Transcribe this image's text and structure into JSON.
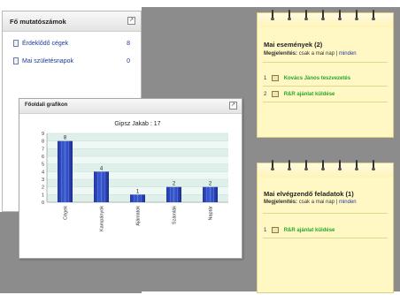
{
  "counters": {
    "title": "Fő mutatószámok",
    "rows": [
      {
        "label": "Érdeklődő cégek",
        "value": "8"
      },
      {
        "label": "Mai születésnapok",
        "value": "0"
      }
    ]
  },
  "chart_window": {
    "title": "Főoldali grafikon"
  },
  "events": {
    "title": "Mai események (2)",
    "display_label": "Megjelenítés:",
    "filter_today": "csak a mai nap",
    "separator": "|",
    "filter_all": "minden",
    "items": [
      {
        "num": "1",
        "icon": "person-icon",
        "text": "Kovács János teszvezetés"
      },
      {
        "num": "2",
        "icon": "mail-icon",
        "text": "R&R ajánlat küldése"
      }
    ]
  },
  "tasks": {
    "title": "Mai elvégzendő feladatok (1)",
    "display_label": "Megjelenítés:",
    "filter_today": "csak a mai nap",
    "separator": "|",
    "filter_all": "minden",
    "items": [
      {
        "num": "1",
        "icon": "mail-icon",
        "text": "R&R ajánlat küldése"
      }
    ]
  },
  "chart_data": {
    "type": "bar",
    "title": "Gipsz Jakab : 17",
    "categories": [
      "Cégek",
      "Kampányok",
      "Ajánlatok",
      "Számlák",
      "Naptár"
    ],
    "values": [
      8,
      4,
      1,
      2,
      2
    ],
    "ylim": [
      0,
      9
    ],
    "yticks": [
      "0",
      "1",
      "2",
      "3",
      "4",
      "5",
      "6",
      "7",
      "8",
      "9"
    ],
    "grid": true,
    "bar_color": "#3f5fd6"
  }
}
